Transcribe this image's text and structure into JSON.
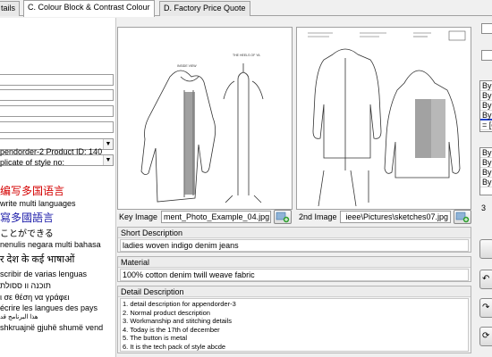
{
  "tabs": [
    {
      "label": "tails"
    },
    {
      "label": "C. Colour Block & Contrast Colour"
    },
    {
      "label": "D. Factory Price Quote"
    }
  ],
  "left": {
    "product_info": "pendorder-2 Product ID: 140",
    "duplicate_label": "plicate of style no:",
    "languages": [
      {
        "text": "编写多国语言",
        "color": "#d40000"
      },
      {
        "text": "write multi languages",
        "color": "#000000"
      },
      {
        "text": "寫多國語言",
        "color": "#1a1aa8"
      },
      {
        "text": "ことができる",
        "color": "#000000"
      },
      {
        "text": "nenulis negara multi bahasa",
        "color": "#000000"
      },
      {
        "text": "र देश के कई भाषाओं",
        "color": "#000000"
      },
      {
        "text": "scribir de varias lenguas",
        "color": "#000000"
      },
      {
        "text": "תוכנה וו ססולת",
        "color": "#000000"
      },
      {
        "text": "ι σε θέση να γράφει",
        "color": "#000000"
      },
      {
        "text": "écrire les langues des pays",
        "color": "#000000"
      },
      {
        "text": "هذا البرنامج قد",
        "color": "#000000"
      },
      {
        "text": "shkruajnë gjuhë shumë vend",
        "color": "#000000"
      }
    ]
  },
  "images": {
    "key_label": "Key Image",
    "key_file": "ment_Photo_Example_04.jpg",
    "second_label": "2nd Image",
    "second_file": "ieee\\Pictures\\sketches07.jpg",
    "sketch_note": "THE HEELS OF YA",
    "sketch_caption": "INSIDE VIEW"
  },
  "short_description": {
    "label": "Short Description",
    "value": "ladies woven indigo denim jeans"
  },
  "material": {
    "label": "Material",
    "value": "100% cotton denim twill weave fabric"
  },
  "detail_description": {
    "label": "Detail Description",
    "lines": [
      "1. detail description for appendorder-3",
      "2. Normal product description",
      "3. Workmanship and stitching details",
      "4. Today is the 17th of december",
      "5. The button is metal",
      "6. It is the tech pack of style abcde"
    ]
  },
  "right": {
    "list1": [
      "Byr",
      "Byr",
      "Byr",
      "Byr",
      "= [c"
    ],
    "list2": [
      "Byr",
      "Byr",
      "Byr",
      "Byr"
    ],
    "digit": "3"
  }
}
